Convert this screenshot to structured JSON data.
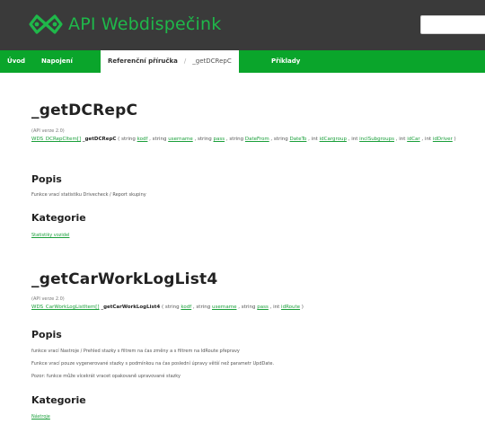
{
  "header": {
    "logo_text": "API Webdispečink",
    "accent": "#1fb84a",
    "search": {
      "value": "",
      "placeholder": ""
    }
  },
  "nav": {
    "items": [
      "Úvod",
      "Napojení",
      "Referenční příručka",
      "_getDCRepC",
      "Příklady"
    ],
    "separator": "/"
  },
  "functions": [
    {
      "title": "_getDCRepC",
      "api_version": "(API verze 2.0)",
      "return_type": "WDS_DCRepCItem[]",
      "name": "_getDCRepC",
      "params": [
        {
          "type": "string",
          "name": "kodf"
        },
        {
          "type": "string",
          "name": "username"
        },
        {
          "type": "string",
          "name": "pass"
        },
        {
          "type": "string",
          "name": "DateFrom"
        },
        {
          "type": "string",
          "name": "DateTo"
        },
        {
          "type": "int",
          "name": "idCargroup"
        },
        {
          "type": "int",
          "name": "inclSubgroups"
        },
        {
          "type": "int",
          "name": "idCar"
        },
        {
          "type": "int",
          "name": "idDriver"
        }
      ],
      "popis_heading": "Popis",
      "popis_lines": [
        "Funkce vrací statistiku Drivecheck / Report skupiny"
      ],
      "kategorie_heading": "Kategorie",
      "kategorie_link": "Statistiky vozidel"
    },
    {
      "title": "_getCarWorkLogList4",
      "api_version": "(API verze 2.0)",
      "return_type": "WDS_CarWorkLogListItem[]",
      "name": "_getCarWorkLogList4",
      "params": [
        {
          "type": "string",
          "name": "kodf"
        },
        {
          "type": "string",
          "name": "username"
        },
        {
          "type": "string",
          "name": "pass"
        },
        {
          "type": "int",
          "name": "idRoute"
        }
      ],
      "popis_heading": "Popis",
      "popis_lines": [
        "funkce vrací Nastroje / Prehled stazky s filtrem na čas změny a s filtrem na IdRoute přepravy",
        "Funkce vrací pouze vygenerované stazky s podmínkou na čas poslední úpravy větší než parametr UpdDate.",
        "Pozor: funkce může vícekrát vracet opakovaně upravované stazky"
      ],
      "kategorie_heading": "Kategorie",
      "kategorie_link": "Nástroje"
    }
  ]
}
